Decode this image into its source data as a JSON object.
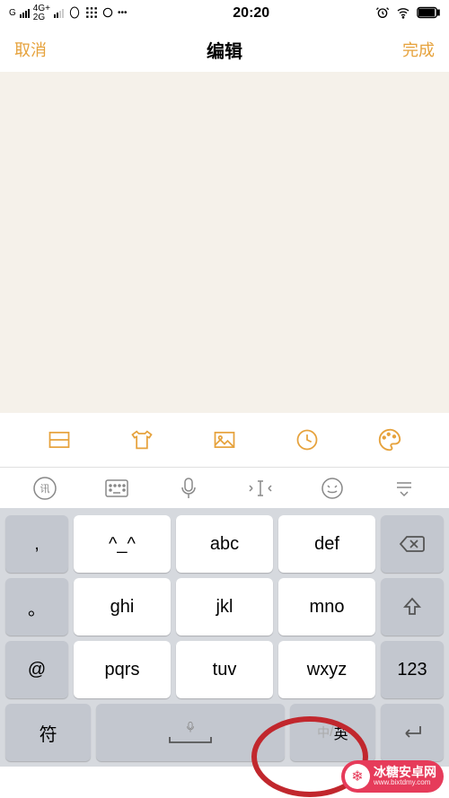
{
  "status": {
    "carrier": "G",
    "net1": "4G+",
    "net2": "2G",
    "time": "20:20"
  },
  "nav": {
    "cancel": "取消",
    "title": "编辑",
    "done": "完成"
  },
  "keyboard": {
    "row1": {
      "k1": ",",
      "k2": "^_^",
      "k3": "abc",
      "k4": "def"
    },
    "row2": {
      "k1": "。",
      "k2": "ghi",
      "k3": "jkl",
      "k4": "mno"
    },
    "row3": {
      "k1": "@",
      "k2": "pqrs",
      "k3": "tuv",
      "k4": "wxyz",
      "k5": "123"
    },
    "row4": {
      "symbols": "符",
      "lang_cn": "中",
      "lang_en": "英"
    }
  },
  "watermark": {
    "title": "冰糖安卓网",
    "url": "www.bixtdmy.com"
  },
  "ime_logo": "讯"
}
